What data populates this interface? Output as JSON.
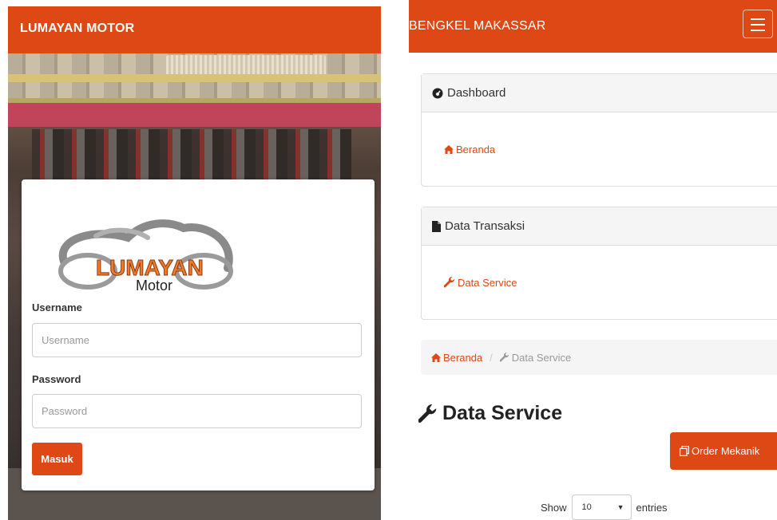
{
  "login": {
    "brand": "LUMAYAN MOTOR",
    "logo_text_1": "LUMAYAN",
    "logo_text_2": "Motor",
    "username_label": "Username",
    "username_placeholder": "Username",
    "username_value": "",
    "password_label": "Password",
    "password_placeholder": "Password",
    "password_value": "",
    "submit_label": "Masuk"
  },
  "app": {
    "brand": "BENGKEL MAKASSAR",
    "menu_icon": "hamburger-icon",
    "panels": [
      {
        "title": "Dashboard",
        "icon": "dashboard-icon",
        "link": "Beranda",
        "link_icon": "home-icon"
      },
      {
        "title": "Data Transaksi",
        "icon": "file-icon",
        "link": "Data Service",
        "link_icon": "wrench-icon"
      }
    ],
    "breadcrumb": {
      "home": "Beranda",
      "separator": "/",
      "current": "Data Service"
    },
    "page_title": "Data Service",
    "order_button": "Order Mekanik",
    "show_label": "Show",
    "entries_value": "10",
    "entries_label": "entries"
  },
  "colors": {
    "accent": "#dd4814",
    "panel_header": "#f5f5f5"
  }
}
